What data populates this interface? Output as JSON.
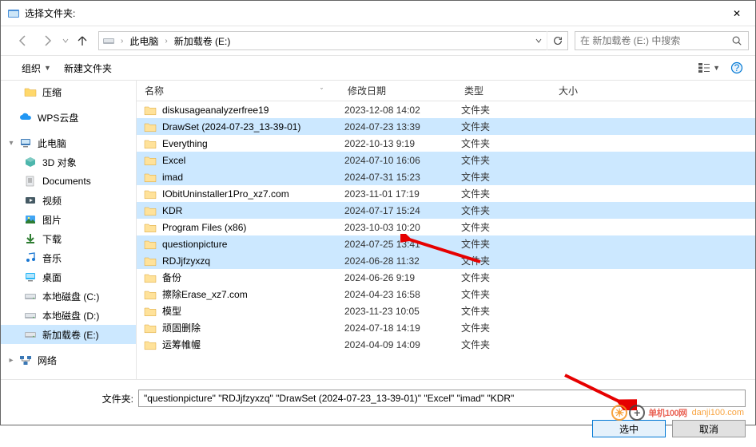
{
  "window": {
    "title": "选择文件夹:",
    "close_glyph": "✕"
  },
  "nav": {
    "breadcrumb": [
      "此电脑",
      "新加载卷 (E:)"
    ],
    "search_placeholder": "在 新加载卷 (E:) 中搜索"
  },
  "toolbar": {
    "organize": "组织",
    "new_folder": "新建文件夹"
  },
  "sidebar": [
    {
      "label": "压缩",
      "level": 2,
      "icon": "folder",
      "expand": ""
    },
    {
      "label": "WPS云盘",
      "level": 1,
      "icon": "cloud",
      "expand": ""
    },
    {
      "label": "此电脑",
      "level": 1,
      "icon": "pc",
      "expand": "▾"
    },
    {
      "label": "3D 对象",
      "level": 2,
      "icon": "3d",
      "expand": ""
    },
    {
      "label": "Documents",
      "level": 2,
      "icon": "docs",
      "expand": ""
    },
    {
      "label": "视频",
      "level": 2,
      "icon": "video",
      "expand": ""
    },
    {
      "label": "图片",
      "level": 2,
      "icon": "pics",
      "expand": ""
    },
    {
      "label": "下载",
      "level": 2,
      "icon": "down",
      "expand": ""
    },
    {
      "label": "音乐",
      "level": 2,
      "icon": "music",
      "expand": ""
    },
    {
      "label": "桌面",
      "level": 2,
      "icon": "desk",
      "expand": ""
    },
    {
      "label": "本地磁盘 (C:)",
      "level": 2,
      "icon": "drive",
      "expand": ""
    },
    {
      "label": "本地磁盘 (D:)",
      "level": 2,
      "icon": "drive",
      "expand": ""
    },
    {
      "label": "新加载卷 (E:)",
      "level": 2,
      "icon": "drive",
      "expand": "",
      "selected": true
    },
    {
      "label": "网络",
      "level": 1,
      "icon": "net",
      "expand": "▸"
    }
  ],
  "columns": {
    "name": "名称",
    "date": "修改日期",
    "type": "类型",
    "size": "大小"
  },
  "files": [
    {
      "name": "diskusageanalyzerfree19",
      "date": "2023-12-08 14:02",
      "type": "文件夹",
      "sel": false
    },
    {
      "name": "DrawSet (2024-07-23_13-39-01)",
      "date": "2024-07-23 13:39",
      "type": "文件夹",
      "sel": true
    },
    {
      "name": "Everything",
      "date": "2022-10-13 9:19",
      "type": "文件夹",
      "sel": false
    },
    {
      "name": "Excel",
      "date": "2024-07-10 16:06",
      "type": "文件夹",
      "sel": true
    },
    {
      "name": "imad",
      "date": "2024-07-31 15:23",
      "type": "文件夹",
      "sel": true
    },
    {
      "name": "IObitUninstaller1Pro_xz7.com",
      "date": "2023-11-01 17:19",
      "type": "文件夹",
      "sel": false
    },
    {
      "name": "KDR",
      "date": "2024-07-17 15:24",
      "type": "文件夹",
      "sel": true
    },
    {
      "name": "Program Files (x86)",
      "date": "2023-10-03 10:20",
      "type": "文件夹",
      "sel": false
    },
    {
      "name": "questionpicture",
      "date": "2024-07-25 13:41",
      "type": "文件夹",
      "sel": true
    },
    {
      "name": "RDJjfzyxzq",
      "date": "2024-06-28 11:32",
      "type": "文件夹",
      "sel": true
    },
    {
      "name": "备份",
      "date": "2024-06-26 9:19",
      "type": "文件夹",
      "sel": false
    },
    {
      "name": "擦除Erase_xz7.com",
      "date": "2024-04-23 16:58",
      "type": "文件夹",
      "sel": false
    },
    {
      "name": "模型",
      "date": "2023-11-23 10:05",
      "type": "文件夹",
      "sel": false
    },
    {
      "name": "顽固删除",
      "date": "2024-07-18 14:19",
      "type": "文件夹",
      "sel": false
    },
    {
      "name": "运筹帷幄",
      "date": "2024-04-09 14:09",
      "type": "文件夹",
      "sel": false
    }
  ],
  "footer": {
    "folder_label": "文件夹:",
    "folder_value": "\"questionpicture\" \"RDJjfzyxzq\" \"DrawSet (2024-07-23_13-39-01)\" \"Excel\" \"imad\" \"KDR\"",
    "select_btn": "选中",
    "cancel_btn": "取消"
  },
  "watermark": {
    "brand1": "单机100网",
    "brand2": "danji100.com"
  }
}
